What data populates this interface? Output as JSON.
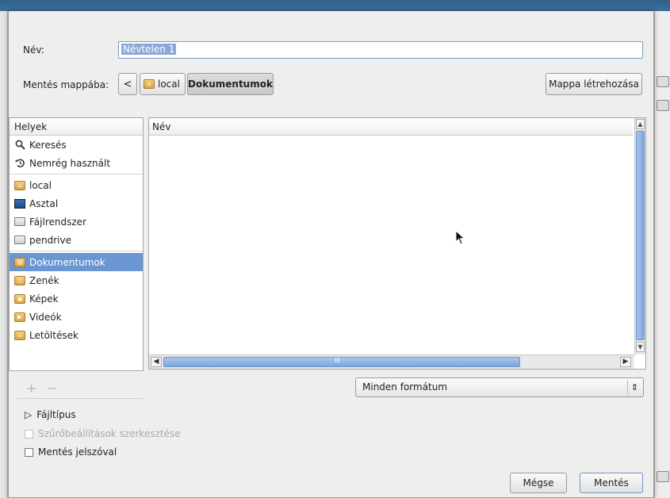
{
  "dialog": {
    "name_label": "Név:",
    "name_value": "Névtelen 1",
    "save_in_label": "Mentés mappába:",
    "breadcrumb": {
      "back_symbol": "<",
      "items": [
        "local",
        "Dokumentumok"
      ]
    },
    "new_folder_button": "Mappa létrehozása",
    "places": {
      "header": "Helyek",
      "items": [
        {
          "label": "Keresés",
          "icon": "search-icon"
        },
        {
          "label": "Nemrég használt",
          "icon": "recent-icon"
        },
        {
          "label": "local",
          "icon": "home-folder-icon"
        },
        {
          "label": "Asztal",
          "icon": "desktop-icon"
        },
        {
          "label": "Fájlrendszer",
          "icon": "drive-icon"
        },
        {
          "label": "pendrive",
          "icon": "drive-icon"
        },
        {
          "label": "Dokumentumok",
          "icon": "documents-folder-icon",
          "selected": true
        },
        {
          "label": "Zenék",
          "icon": "music-folder-icon"
        },
        {
          "label": "Képek",
          "icon": "pictures-folder-icon"
        },
        {
          "label": "Videók",
          "icon": "videos-folder-icon"
        },
        {
          "label": "Letöltések",
          "icon": "downloads-folder-icon"
        }
      ],
      "add_symbol": "+",
      "remove_symbol": "−"
    },
    "file_list": {
      "column_header": "Név",
      "scroll_mid": "III"
    },
    "format_select": "Minden formátum",
    "file_type_expander": "Fájltípus",
    "filter_options_label": "Szűrőbeállítások szerkesztése",
    "password_label": "Mentés jelszóval",
    "cancel_button": "Mégse",
    "save_button": "Mentés"
  },
  "colors": {
    "selection": "#6a96d2",
    "dialog_bg": "#eeeeec",
    "accent_border": "#7a9cc6"
  }
}
